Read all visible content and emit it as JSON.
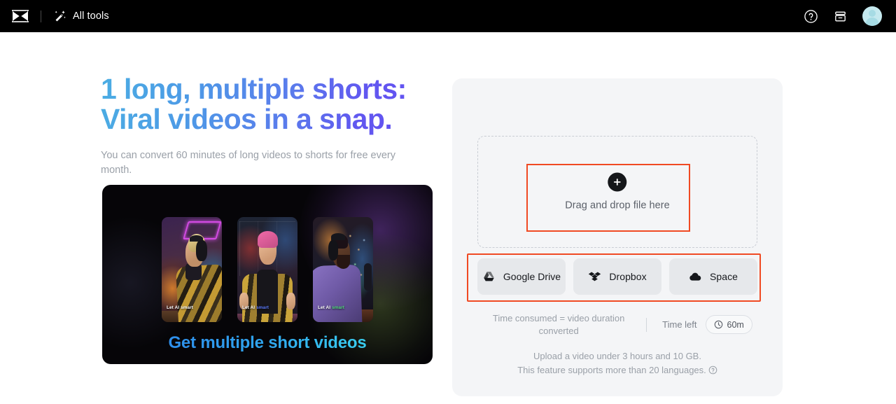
{
  "header": {
    "logo": "capcut-logo",
    "all_tools_label": "All tools",
    "wand_icon": "magic-wand-icon",
    "help_icon": "help-circle-icon",
    "archive_icon": "archive-box-icon",
    "avatar": "user-avatar"
  },
  "hero": {
    "headline": "1 long, multiple shorts: Viral videos in a snap.",
    "subhead": "You can convert 60 minutes of long videos to shorts for free every month.",
    "gradient_start": "#4BADE3",
    "gradient_end": "#6450F2"
  },
  "promo": {
    "title": "Get multiple short videos",
    "title_gradient_start": "#2E7FE8",
    "title_gradient_end": "#3FE8F0",
    "cards": [
      {
        "caption_plain": "Let AI",
        "caption_accent": "smart",
        "accent_color": "#ffffff"
      },
      {
        "caption_plain": "Let AI",
        "caption_accent": "smart",
        "accent_color": "#5b7bff"
      },
      {
        "caption_plain": "Let AI",
        "caption_accent": "smart",
        "accent_color": "#4fd97a"
      }
    ]
  },
  "upload": {
    "plus_icon": "plus-icon",
    "dropzone_label": "Drag and drop file here",
    "cloud_buttons": [
      {
        "label": "Google Drive",
        "icon": "google-drive-icon"
      },
      {
        "label": "Dropbox",
        "icon": "dropbox-icon"
      },
      {
        "label": "Space",
        "icon": "cloud-icon"
      }
    ],
    "time_note": "Time consumed = video duration converted",
    "time_left_label": "Time left",
    "time_left_value": "60m",
    "clock_icon": "clock-icon",
    "footnote_line1": "Upload a video under 3 hours and 10 GB.",
    "footnote_line2": "This feature supports more than 20 languages.",
    "help_icon": "help-circle-icon"
  },
  "annotations": {
    "color": "#f04a23",
    "boxes": [
      "dropzone-highlight",
      "cloud-buttons-highlight"
    ]
  }
}
